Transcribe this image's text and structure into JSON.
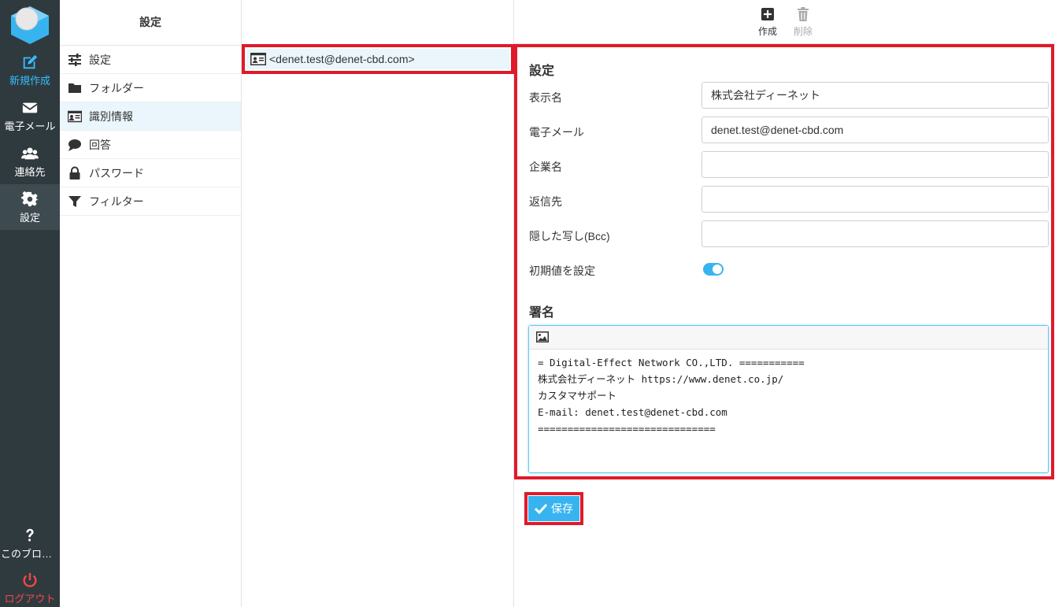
{
  "rail": {
    "compose": "新規作成",
    "mail": "電子メール",
    "contacts": "連絡先",
    "settings": "設定",
    "about": "このブログ...",
    "logout": "ログアウト"
  },
  "settings_nav": {
    "title": "設定",
    "items": [
      {
        "label": "設定",
        "icon": "sliders-icon"
      },
      {
        "label": "フォルダー",
        "icon": "folder-icon"
      },
      {
        "label": "識別情報",
        "icon": "id-card-icon"
      },
      {
        "label": "回答",
        "icon": "speech-bubble-icon"
      },
      {
        "label": "パスワード",
        "icon": "lock-icon"
      },
      {
        "label": "フィルター",
        "icon": "funnel-icon"
      }
    ]
  },
  "identities": {
    "selected": "<denet.test@denet-cbd.com>"
  },
  "toolbar": {
    "create": "作成",
    "delete": "削除"
  },
  "form": {
    "settings_title": "設定",
    "display_name_label": "表示名",
    "display_name_value": "株式会社ディーネット",
    "email_label": "電子メール",
    "email_value": "denet.test@denet-cbd.com",
    "organization_label": "企業名",
    "organization_value": "",
    "reply_to_label": "返信先",
    "reply_to_value": "",
    "bcc_label": "隠した写し(Bcc)",
    "bcc_value": "",
    "default_label": "初期値を設定",
    "default_on": true,
    "signature_title": "署名",
    "signature_lines": [
      "= Digital-Effect Network CO.,LTD. ===========",
      "株式会社ディーネット https://www.denet.co.jp/",
      "カスタマサポート",
      "E-mail: denet.test@denet-cbd.com",
      "=============================="
    ]
  },
  "save_label": "保存",
  "colors": {
    "rail_bg": "#2f3a3f",
    "accent": "#37b4f0",
    "highlight_border": "#e01a2a",
    "logout": "#f04a4a"
  }
}
